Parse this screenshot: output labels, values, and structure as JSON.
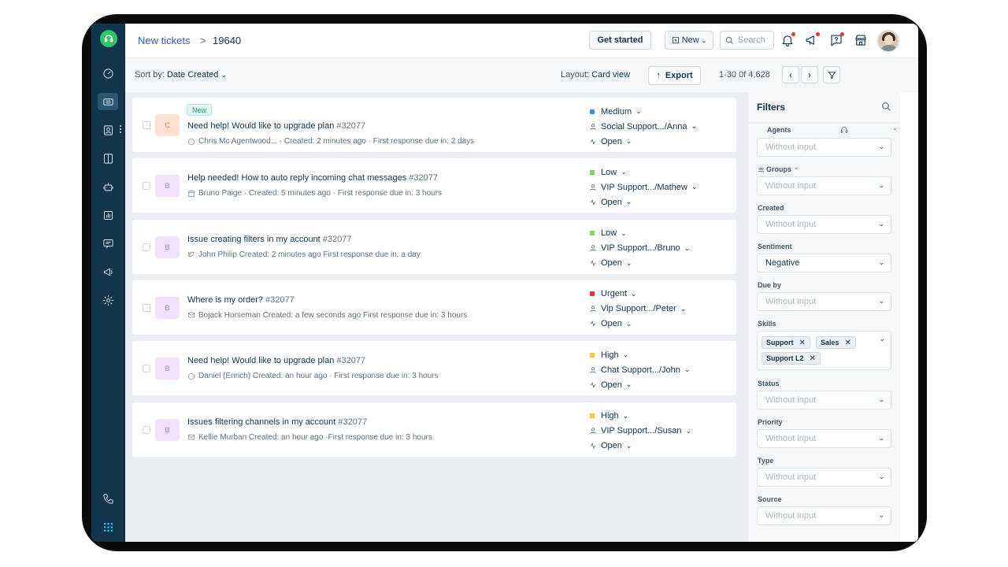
{
  "breadcrumb": {
    "link": "New tickets",
    "separator": ">",
    "current": "19640"
  },
  "header": {
    "get_started": "Get started",
    "new_label": "New",
    "search_placeholder": "Search"
  },
  "toolbar": {
    "sort_prefix": "Sort by:",
    "sort_value": "Date Created",
    "layout_prefix": "Layout:",
    "layout_value": "Card view",
    "export_label": "Export",
    "pagination": "1-30 0f 4,628"
  },
  "tickets": [
    {
      "badge": "New",
      "avatar": "C",
      "subject": "Need help! Would like to upgrade plan",
      "number": "#32077",
      "meta": "Chris Mc Agentwood... · Created: 2 minutes ago · First response due in: 2 days",
      "priority": "Medium",
      "priority_color": "#3d8fe0",
      "group": "Social Support.../Anna",
      "status": "Open",
      "channel_icon": "chat-icon"
    },
    {
      "avatar": "B",
      "subject": "Help needed! How to auto reply incoming chat messages",
      "number": "#32077",
      "meta": "Bruno Paige · Created: 5 minutes ago · First response due in: 3 hours",
      "priority": "Low",
      "priority_color": "#8bcb5b",
      "group": "VIP Support.../Mathew",
      "status": "Open",
      "channel_icon": "portal-icon"
    },
    {
      "avatar": "B",
      "subject": "Issue creating filters in my account",
      "number": "#32077",
      "meta": "John Philip   Created: 2 minutes ago   First response due in: a day",
      "priority": "Low",
      "priority_color": "#8bcb5b",
      "group": "VIP Support.../Bruno",
      "status": "Open",
      "channel_icon": "twitter-icon"
    },
    {
      "avatar": "B",
      "subject": "Where is my order?",
      "number": "#32077",
      "meta": "Bojack Horseman   Created: a few seconds ago   First response due in: 3 hours",
      "priority": "Urgent",
      "priority_color": "#e43538",
      "group": "Vip Support.../Peter",
      "status": "Open",
      "channel_icon": "email-icon"
    },
    {
      "avatar": "B",
      "subject": "Need help! Would like to upgrade plan",
      "number": "#32077",
      "meta": "Daniel (Enrich)   Created: an hour ago · First response due in: 3 hours",
      "priority": "High",
      "priority_color": "#f5c645",
      "group": "Chat Support.../John",
      "status": "Open",
      "channel_icon": "chat-icon"
    },
    {
      "avatar": "B",
      "subject": "Issues filtering channels in my account",
      "number": "#32077",
      "meta": "Kellie Murban   Created: an hour ago ·First response due in: 3 hours",
      "priority": "High",
      "priority_color": "#f5c645",
      "group": "VIP Support.../Susan",
      "status": "Open",
      "channel_icon": "email-icon"
    }
  ],
  "filters": {
    "title": "Filters",
    "agents_label": "Agents",
    "groups_label": "Groups",
    "created_label": "Created",
    "sentiment_label": "Sentiment",
    "dueby_label": "Due by",
    "skills_label": "Skills",
    "status_label": "Status",
    "priority_label": "Priority",
    "type_label": "Type",
    "source_label": "Source",
    "placeholder": "Without input",
    "sentiment_value": "Negative",
    "skills_tags": [
      "Support",
      "Sales",
      "Support L2"
    ]
  }
}
